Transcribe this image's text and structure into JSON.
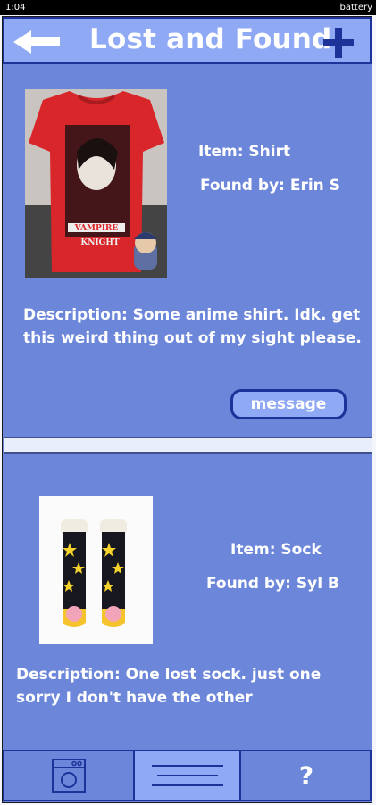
{
  "status_bar": {
    "time": "1:04",
    "battery": "battery"
  },
  "header": {
    "title": "Lost and Found",
    "back_icon": "arrow-left-icon",
    "add_icon": "plus-icon"
  },
  "items": [
    {
      "item_label": "Item: Shirt",
      "found_by_label": "Found by: Erin S",
      "description": "Description: Some anime shirt. Idk. get this weird thing out of my sight please.",
      "action_label": "message",
      "image": "shirt-photo"
    },
    {
      "item_label": "Item: Sock",
      "found_by_label": "Found by: Syl B",
      "description": "Description: One lost sock. just one sorry I don't have the other",
      "image": "sock-photo"
    }
  ],
  "bottom_nav": [
    {
      "icon": "washing-machine-icon"
    },
    {
      "icon": "menu-lines-icon",
      "active": true
    },
    {
      "icon": "help-icon",
      "label": "?"
    }
  ],
  "colors": {
    "panel": "#6c86d9",
    "header": "#8fa9f4",
    "border": "#1e3399",
    "text": "#ffffff"
  }
}
